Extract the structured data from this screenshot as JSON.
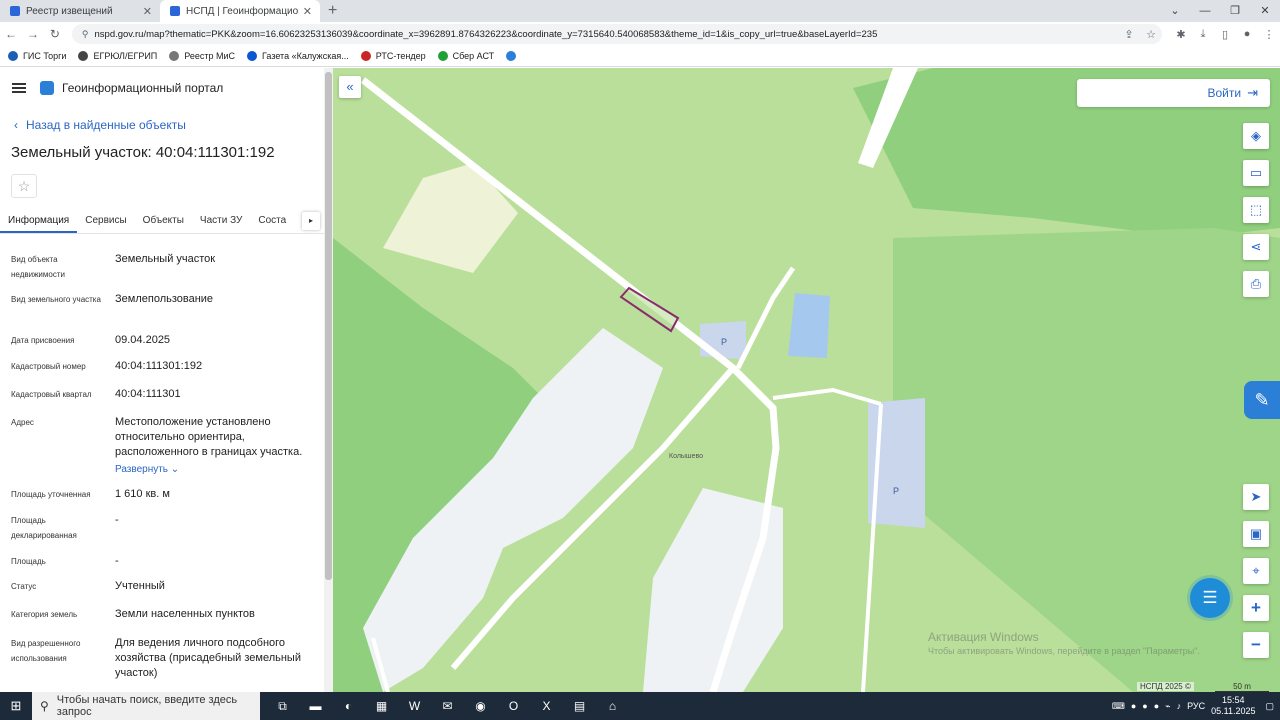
{
  "browser": {
    "tabs": [
      {
        "title": "Реестр извещений"
      },
      {
        "title": "НСПД | Геоинформационный п"
      }
    ],
    "url": "nspd.gov.ru/map?thematic=PKK&zoom=16.60623253136039&coordinate_x=3962891.8764326223&coordinate_y=7315640.540068583&theme_id=1&is_copy_url=true&baseLayerId=235",
    "bookmarks": [
      {
        "label": "ГИС Торги",
        "color": "#1a5fb4"
      },
      {
        "label": "ЕГРЮЛ/ЕГРИП",
        "color": "#444444"
      },
      {
        "label": "Реестр МиС",
        "color": "#777777"
      },
      {
        "label": "Газета «Калужская...",
        "color": "#0b57d0"
      },
      {
        "label": "РТС-тендер",
        "color": "#c62828"
      },
      {
        "label": "Сбер АСТ",
        "color": "#21a038"
      }
    ]
  },
  "portal": {
    "name": "Геоинформационный портал",
    "back": "Назад в найденные объекты",
    "title": "Земельный участок: 40:04:111301:192",
    "tabs": [
      "Информация",
      "Сервисы",
      "Объекты",
      "Части ЗУ",
      "Соста"
    ],
    "properties": [
      {
        "key": "Вид объекта недвижимости",
        "value": "Земельный участок"
      },
      {
        "key": "Вид земельного участка",
        "value": "Землепользование"
      },
      {
        "key": "Дата присвоения",
        "value": "09.04.2025"
      },
      {
        "key": "Кадастровый номер",
        "value": "40:04:111301:192"
      },
      {
        "key": "Кадастровый квартал",
        "value": "40:04:111301"
      },
      {
        "key": "Адрес",
        "value": "Местоположение установлено относительно ориентира, расположенного в границах участка.",
        "expand": "Развернуть"
      },
      {
        "key": "Площадь уточненная",
        "value": "1 610 кв. м"
      },
      {
        "key": "Площадь декларированная",
        "value": "-"
      },
      {
        "key": "Площадь",
        "value": "-"
      },
      {
        "key": "Статус",
        "value": "Учтенный"
      },
      {
        "key": "Категория земель",
        "value": "Земли населенных пунктов"
      },
      {
        "key": "Вид разрешенного использования",
        "value": "Для ведения личного подсобного хозяйства (присадебный земельный участок)"
      }
    ]
  },
  "map": {
    "login": "Войти",
    "village_label": "Колышево",
    "parking_label": "P",
    "copyright": "НСПД 2025 ©",
    "scale": "50 m",
    "watermark_title": "Активация Windows",
    "watermark_sub": "Чтобы активировать Windows, перейдите в раздел \"Параметры\".",
    "colors": {
      "land": "#b9df9b",
      "forest": "#8fcf7d",
      "road": "#ffffff",
      "water": "#a5c8ee",
      "parcel": "#8a2b6e"
    }
  },
  "taskbar": {
    "search_placeholder": "Чтобы начать поиск, введите здесь запрос",
    "lang": "РУС",
    "time": "15:54",
    "date": "05.11.2025"
  }
}
